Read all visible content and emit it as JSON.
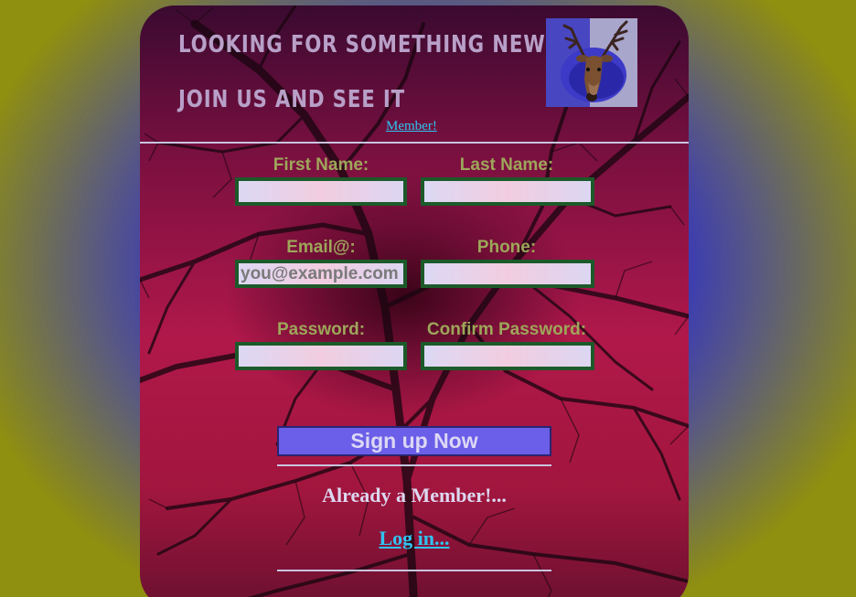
{
  "header": {
    "title_line1": "LOOKING FOR SOMETHING NEW",
    "title_line2": "JOIN US AND SEE IT",
    "member_link": "Member!",
    "logo_icon": "deer-head-icon"
  },
  "form": {
    "first_name_label": "First Name:",
    "last_name_label": "Last Name:",
    "email_label": "Email@:",
    "email_placeholder": "you@example.com",
    "phone_label": "Phone:",
    "password_label": "Password:",
    "confirm_password_label": "Confirm Password:",
    "submit_label": "Sign up Now"
  },
  "footer": {
    "already_member_text": "Already a Member!...",
    "login_link": "Log in..."
  },
  "colors": {
    "label": "#9ea65a",
    "link": "#2fc4f2",
    "button": "#6b5ee8",
    "field_border": "#1c5a2a"
  }
}
